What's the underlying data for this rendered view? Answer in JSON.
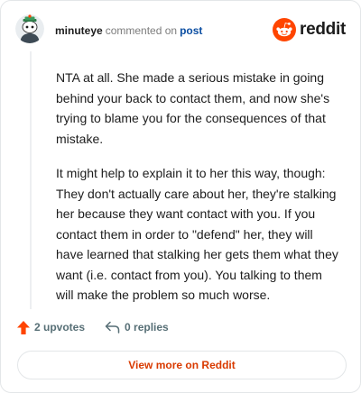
{
  "comment": {
    "username": "minuteye",
    "action": "commented on",
    "target": "post",
    "paragraphs": [
      "NTA at all. She made a serious mistake in going behind your back to contact them, and now she's trying to blame you for the consequences of that mistake.",
      "It might help to explain it to her this way, though: They don't actually care about her, they're stalking her because they want contact with you. If you contact them in order to \"defend\" her, they will have learned that stalking her gets them what they want (i.e. contact from you). You talking to them will make the problem so much worse."
    ]
  },
  "logo": {
    "wordmark": "reddit",
    "icon": "reddit-alien-icon"
  },
  "footer": {
    "upvotes_label": "2 upvotes",
    "replies_label": "0 replies",
    "upvote_icon": "upvote-arrow-icon",
    "reply_icon": "reply-arrow-icon"
  },
  "cta": {
    "label": "View more on Reddit"
  },
  "colors": {
    "accent": "#d93a00",
    "upvote": "#ff4500",
    "link": "#0b4ea2",
    "muted": "#576f76"
  }
}
